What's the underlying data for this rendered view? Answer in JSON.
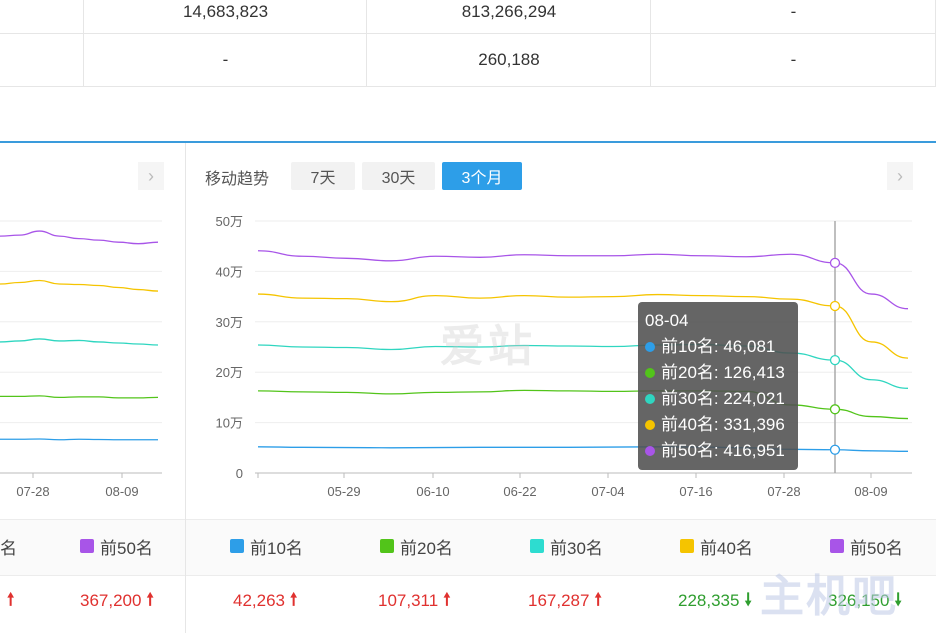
{
  "top_table": {
    "row1": [
      "14,683,823",
      "813,266,294",
      "-"
    ],
    "row2": [
      "-",
      "260,188",
      "-"
    ]
  },
  "trend": {
    "label": "移动趋势",
    "ranges": [
      "7天",
      "30天",
      "3个月"
    ],
    "active_range": "3个月"
  },
  "tooltip": {
    "date": "08-04",
    "rows": [
      {
        "text": "前10名: 46,081",
        "color": "#2d9ee8"
      },
      {
        "text": "前20名: 126,413",
        "color": "#52c41a"
      },
      {
        "text": "前30名: 224,021",
        "color": "#2fd6c0"
      },
      {
        "text": "前40名: 331,396",
        "color": "#f5c400"
      },
      {
        "text": "前50名: 416,951",
        "color": "#a855e8"
      }
    ]
  },
  "watermark": "爱站",
  "legend": {
    "left_partial": [
      "名",
      "前50名"
    ],
    "right": [
      "前10名",
      "前20名",
      "前30名",
      "前40名",
      "前50名"
    ],
    "colors": [
      "#2d9ee8",
      "#52c41a",
      "#2ddcd0",
      "#f5c400",
      "#a855e8"
    ]
  },
  "values": {
    "left_partial": [
      {
        "v": "",
        "dir": "up"
      },
      {
        "v": "367,200",
        "dir": "up"
      }
    ],
    "right": [
      {
        "v": "42,263",
        "dir": "up"
      },
      {
        "v": "107,311",
        "dir": "up"
      },
      {
        "v": "167,287",
        "dir": "up"
      },
      {
        "v": "228,335",
        "dir": "down"
      },
      {
        "v": "326,150",
        "dir": "down"
      }
    ]
  },
  "site_mark": "主机吧",
  "chart_data": {
    "type": "line",
    "y_tick_labels": [
      "0",
      "10万",
      "20万",
      "30万",
      "40万",
      "50万"
    ],
    "ylim": [
      0,
      500000
    ],
    "x_tick_labels": [
      "05-29",
      "06-10",
      "06-22",
      "07-04",
      "07-16",
      "07-28",
      "08-09"
    ],
    "left_x_tick_labels": [
      "07-28",
      "08-09"
    ],
    "highlight": "08-04",
    "series": [
      {
        "name": "前10名",
        "color": "#2d9ee8",
        "values": [
          52000,
          51000,
          50500,
          50000,
          50500,
          51000,
          51000,
          51000,
          51500,
          52000,
          51500,
          50000,
          47000,
          46081,
          44000,
          43000
        ]
      },
      {
        "name": "前20名",
        "color": "#52c41a",
        "values": [
          163000,
          161000,
          160000,
          157000,
          160000,
          161000,
          164000,
          163000,
          162000,
          163000,
          163000,
          162000,
          135000,
          126413,
          112000,
          108000
        ]
      },
      {
        "name": "前30名",
        "color": "#2fd6c0",
        "values": [
          254000,
          250000,
          249000,
          245000,
          251000,
          250000,
          253000,
          252000,
          251000,
          254000,
          255000,
          252000,
          238000,
          224021,
          185000,
          168000
        ]
      },
      {
        "name": "前40名",
        "color": "#f5c400",
        "values": [
          355000,
          347000,
          346000,
          340000,
          352000,
          347000,
          352000,
          349000,
          350000,
          354000,
          352000,
          350000,
          345000,
          331396,
          260000,
          228000
        ]
      },
      {
        "name": "前50名",
        "color": "#a855e8",
        "values": [
          441000,
          430000,
          426000,
          421000,
          430000,
          428000,
          433000,
          431000,
          431000,
          434000,
          431000,
          429000,
          434000,
          416951,
          355000,
          326000
        ]
      }
    ],
    "left_series_partial": [
      {
        "name": "前10名",
        "values": [
          67000,
          67000,
          67500,
          66000,
          67000,
          66500,
          66000,
          66000,
          66000
        ]
      },
      {
        "name": "前20名",
        "values": [
          152000,
          152000,
          153000,
          150000,
          151000,
          151000,
          149000,
          149000,
          150000
        ]
      },
      {
        "name": "前30名",
        "values": [
          260000,
          262000,
          266000,
          262000,
          263000,
          260000,
          258000,
          256000,
          254000
        ]
      },
      {
        "name": "前40名",
        "values": [
          375000,
          378000,
          382000,
          375000,
          374000,
          372000,
          368000,
          364000,
          361000
        ]
      },
      {
        "name": "前50名",
        "values": [
          470000,
          472000,
          480000,
          470000,
          465000,
          462000,
          458000,
          455000,
          458000
        ]
      }
    ]
  }
}
